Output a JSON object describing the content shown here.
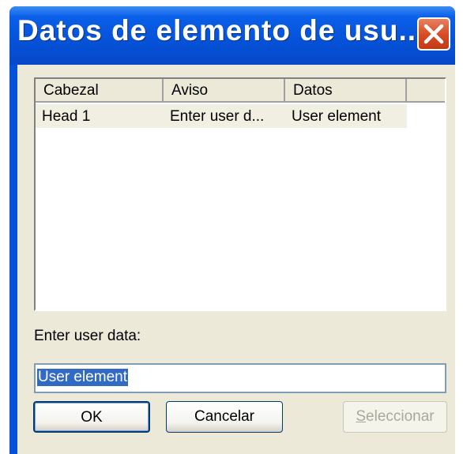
{
  "window": {
    "title": "Datos de elemento de usu...",
    "close_icon": "close-icon"
  },
  "listview": {
    "columns": [
      "Cabezal",
      "Aviso",
      "Datos"
    ],
    "rows": [
      [
        "Head 1",
        "Enter user d...",
        "User element"
      ]
    ]
  },
  "prompt_label": "Enter user data:",
  "input": {
    "value": "User element"
  },
  "buttons": {
    "ok": "OK",
    "cancel": "Cancelar",
    "select_first": "S",
    "select_rest": "eleccionar"
  },
  "colors": {
    "titlebar": "#0552d8",
    "close": "#d44a24",
    "face": "#ece9d8",
    "selection": "#316ac5"
  }
}
